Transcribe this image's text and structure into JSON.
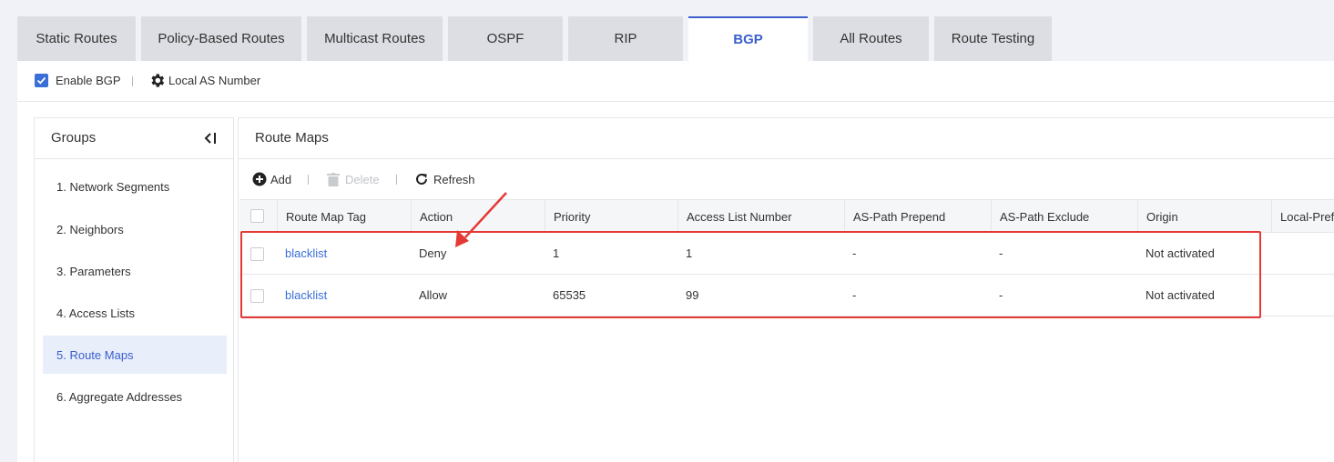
{
  "tabs": [
    {
      "label": "Static Routes",
      "active": false
    },
    {
      "label": "Policy-Based Routes",
      "active": false
    },
    {
      "label": "Multicast Routes",
      "active": false
    },
    {
      "label": "OSPF",
      "active": false
    },
    {
      "label": "RIP",
      "active": false
    },
    {
      "label": "BGP",
      "active": true
    },
    {
      "label": "All Routes",
      "active": false
    },
    {
      "label": "Route Testing",
      "active": false
    }
  ],
  "topbar": {
    "enable_label": "Enable BGP",
    "enable_checked": true,
    "local_as_label": "Local AS Number"
  },
  "groups": {
    "title": "Groups",
    "items": [
      {
        "label": "1. Network Segments",
        "active": false
      },
      {
        "label": "2. Neighbors",
        "active": false
      },
      {
        "label": "3. Parameters",
        "active": false
      },
      {
        "label": "4. Access Lists",
        "active": false
      },
      {
        "label": "5. Route Maps",
        "active": true
      },
      {
        "label": "6. Aggregate Addresses",
        "active": false
      }
    ]
  },
  "route_maps": {
    "title": "Route Maps",
    "toolbar": {
      "add_label": "Add",
      "delete_label": "Delete",
      "refresh_label": "Refresh"
    },
    "columns": [
      "Route Map Tag",
      "Action",
      "Priority",
      "Access List Number",
      "AS-Path Prepend",
      "AS-Path Exclude",
      "Origin",
      "Local-Pref"
    ],
    "rows": [
      [
        "blacklist",
        "Deny",
        "1",
        "1",
        "-",
        "-",
        "Not activated",
        ""
      ],
      [
        "blacklist",
        "Allow",
        "65535",
        "99",
        "-",
        "-",
        "Not activated",
        ""
      ]
    ]
  },
  "colors": {
    "accent": "#3a5fcd",
    "annotation": "#e53935"
  },
  "icons": [
    "check-icon",
    "gear-icon",
    "collapse-icon",
    "add-icon",
    "trash-icon",
    "refresh-icon"
  ]
}
